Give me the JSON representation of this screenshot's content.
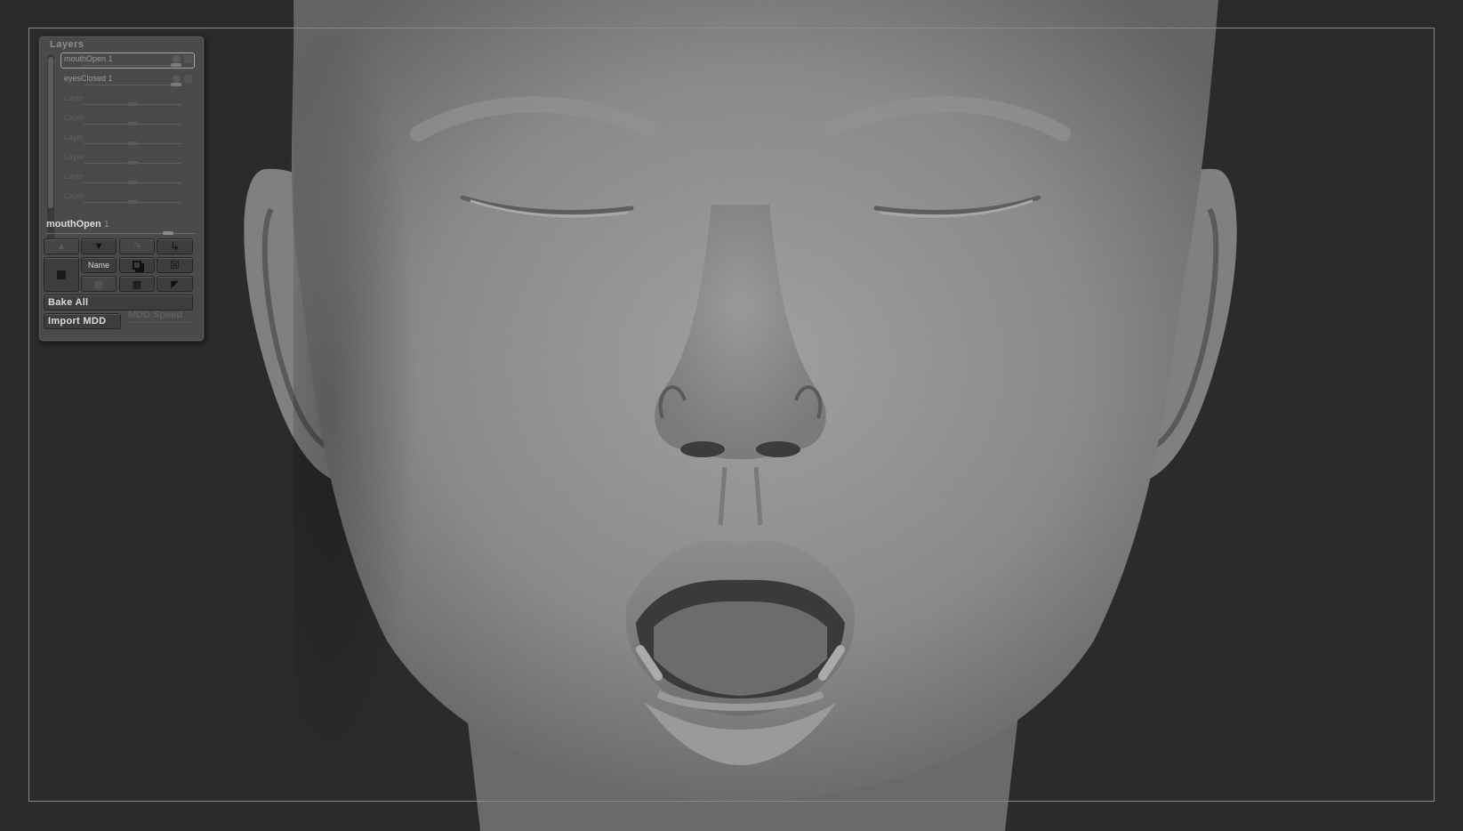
{
  "layers_panel": {
    "title": "Layers",
    "layers": [
      {
        "name": "mouthOpen",
        "index": "1",
        "active": true,
        "dim": false,
        "value": 1.0
      },
      {
        "name": "eyesClosed",
        "index": "1",
        "active": false,
        "dim": false,
        "value": 1.0
      },
      {
        "name": "Layer",
        "index": "",
        "active": false,
        "dim": true,
        "value": 0.5
      },
      {
        "name": "Layer",
        "index": "",
        "active": false,
        "dim": true,
        "value": 0.5
      },
      {
        "name": "Layer",
        "index": "",
        "active": false,
        "dim": true,
        "value": 0.5
      },
      {
        "name": "Layer",
        "index": "",
        "active": false,
        "dim": true,
        "value": 0.5
      },
      {
        "name": "Layer",
        "index": "",
        "active": false,
        "dim": true,
        "value": 0.5
      },
      {
        "name": "Layer",
        "index": "",
        "active": false,
        "dim": true,
        "value": 0.5
      }
    ],
    "current_layer": {
      "name": "mouthOpen",
      "index": "1",
      "value": 1.0
    },
    "buttons": {
      "name": "Name",
      "bake_all": "Bake All",
      "import_mdd": "Import MDD",
      "mdd_speed": "MDD Speed"
    },
    "icons": {
      "move_up": "arrow-up-icon",
      "move_down": "arrow-down-icon",
      "redo": "redo-icon",
      "return": "return-icon",
      "new": "new-layer-icon",
      "copy": "copy-icon",
      "delete": "delete-icon",
      "split": "split-icon",
      "merge": "merge-icon",
      "append": "append-icon"
    },
    "colors": {
      "panel": "#4a4a4a",
      "background": "#2b2b2b"
    }
  }
}
